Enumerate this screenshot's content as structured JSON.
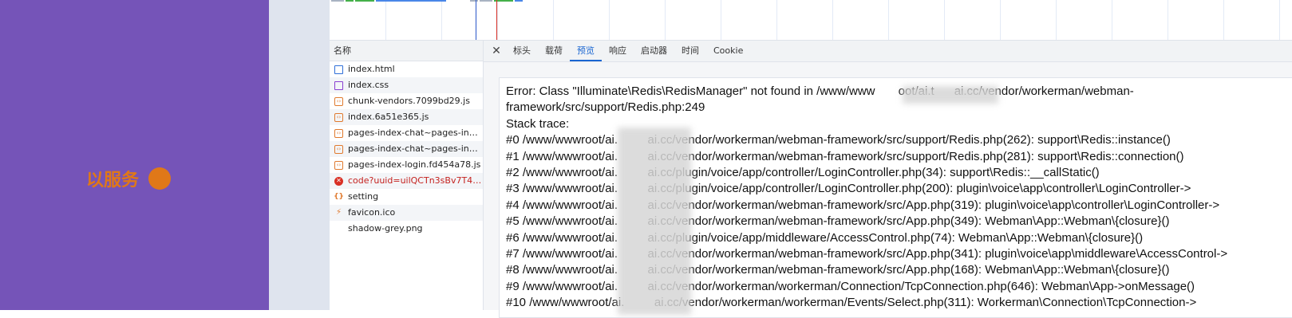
{
  "left_panel": {
    "label": "以服务",
    "accent_color": "#e07818",
    "background": "#7554b8"
  },
  "list": {
    "header": "名称",
    "items": [
      {
        "icon": "document-icon",
        "name": "index.html",
        "status": "ok"
      },
      {
        "icon": "stylesheet-icon",
        "name": "index.css",
        "status": "ok"
      },
      {
        "icon": "script-icon",
        "name": "chunk-vendors.7099bd29.js",
        "status": "ok"
      },
      {
        "icon": "script-icon",
        "name": "index.6a51e365.js",
        "status": "ok"
      },
      {
        "icon": "script-icon",
        "name": "pages-index-chat~pages-inde...",
        "status": "ok"
      },
      {
        "icon": "script-icon",
        "name": "pages-index-chat~pages-inde...",
        "status": "ok"
      },
      {
        "icon": "script-icon",
        "name": "pages-index-login.fd454a78.js",
        "status": "ok"
      },
      {
        "icon": "error-icon",
        "name": "code?uuid=uilQCTn3sBv7T4a8...",
        "status": "error"
      },
      {
        "icon": "json-icon",
        "name": "setting",
        "status": "ok"
      },
      {
        "icon": "favicon-icon",
        "name": "favicon.ico",
        "status": "ok"
      },
      {
        "icon": "none",
        "name": "shadow-grey.png",
        "status": "ok"
      }
    ]
  },
  "tabs": {
    "close_label": "✕",
    "items": [
      "标头",
      "载荷",
      "预览",
      "响应",
      "启动器",
      "时间",
      "Cookie"
    ],
    "active": "预览"
  },
  "preview": {
    "lines": [
      "Error: Class \"Illuminate\\Redis\\RedisManager\" not found in /www/www       oot/ai.t      ai.cc/vendor/workerman/webman-",
      "framework/src/support/Redis.php:249",
      "Stack trace:",
      "#0 /www/wwwroot/ai.         ai.cc/vendor/workerman/webman-framework/src/support/Redis.php(262): support\\Redis::instance()",
      "#1 /www/wwwroot/ai.         ai.cc/vendor/workerman/webman-framework/src/support/Redis.php(281): support\\Redis::connection()",
      "#2 /www/wwwroot/ai.         ai.cc/plugin/voice/app/controller/LoginController.php(34): support\\Redis::__callStatic()",
      "#3 /www/wwwroot/ai.         ai.cc/plugin/voice/app/controller/LoginController.php(200): plugin\\voice\\app\\controller\\LoginController->",
      "#4 /www/wwwroot/ai.         ai.cc/vendor/workerman/webman-framework/src/App.php(319): plugin\\voice\\app\\controller\\LoginController->",
      "#5 /www/wwwroot/ai.         ai.cc/vendor/workerman/webman-framework/src/App.php(349): Webman\\App::Webman\\{closure}()",
      "#6 /www/wwwroot/ai.         ai.cc/plugin/voice/app/middleware/AccessControl.php(74): Webman\\App::Webman\\{closure}()",
      "#7 /www/wwwroot/ai.         ai.cc/vendor/workerman/webman-framework/src/App.php(341): plugin\\voice\\app\\middleware\\AccessControl->",
      "#8 /www/wwwroot/ai.         ai.cc/vendor/workerman/webman-framework/src/App.php(168): Webman\\App::Webman\\{closure}()",
      "#9 /www/wwwroot/ai.         ai.cc/vendor/workerman/workerman/Connection/TcpConnection.php(646): Webman\\App->onMessage()",
      "#10 /www/wwwroot/ai.         ai.cc/vendor/workerman/workerman/Events/Select.php(311): Workerman\\Connection\\TcpConnection->"
    ]
  },
  "colors": {
    "tab_active": "#1a66d1",
    "error_text": "#c5221f",
    "timeline_marker_blue": "#2a57c9",
    "timeline_marker_red": "#d93025"
  }
}
